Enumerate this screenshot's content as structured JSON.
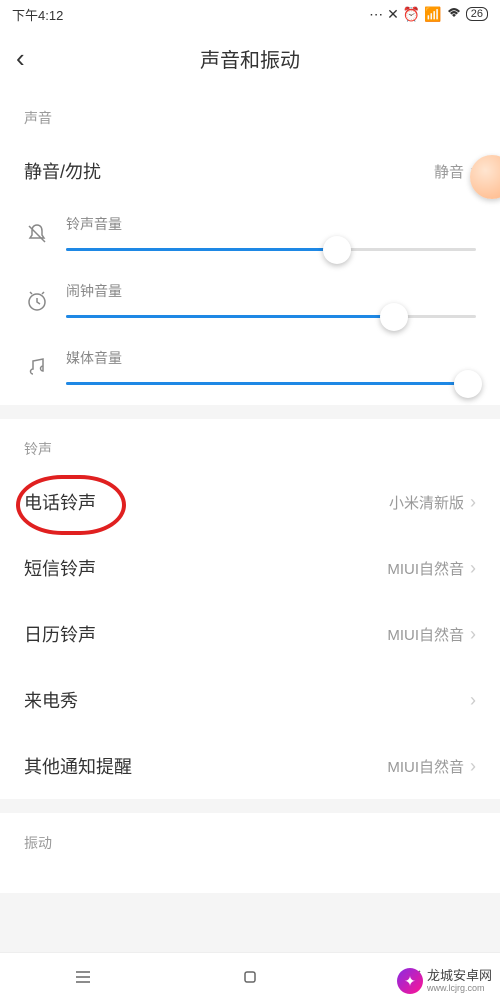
{
  "status": {
    "time": "下午4:12",
    "battery": "26"
  },
  "header": {
    "title": "声音和振动"
  },
  "sections": {
    "sound": {
      "title": "声音",
      "silent": {
        "label": "静音/勿扰",
        "value": "静音"
      },
      "sliders": {
        "ringtone": {
          "label": "铃声音量",
          "percent": 66
        },
        "alarm": {
          "label": "闹钟音量",
          "percent": 80
        },
        "media": {
          "label": "媒体音量",
          "percent": 98
        }
      }
    },
    "ringtone": {
      "title": "铃声",
      "items": {
        "phone": {
          "label": "电话铃声",
          "value": "小米清新版"
        },
        "sms": {
          "label": "短信铃声",
          "value": "MIUI自然音"
        },
        "calendar": {
          "label": "日历铃声",
          "value": "MIUI自然音"
        },
        "callshow": {
          "label": "来电秀",
          "value": ""
        },
        "other": {
          "label": "其他通知提醒",
          "value": "MIUI自然音"
        }
      }
    },
    "vibration": {
      "title": "振动"
    }
  },
  "watermark": {
    "text": "龙城安卓网",
    "url": "www.lcjrg.com"
  }
}
